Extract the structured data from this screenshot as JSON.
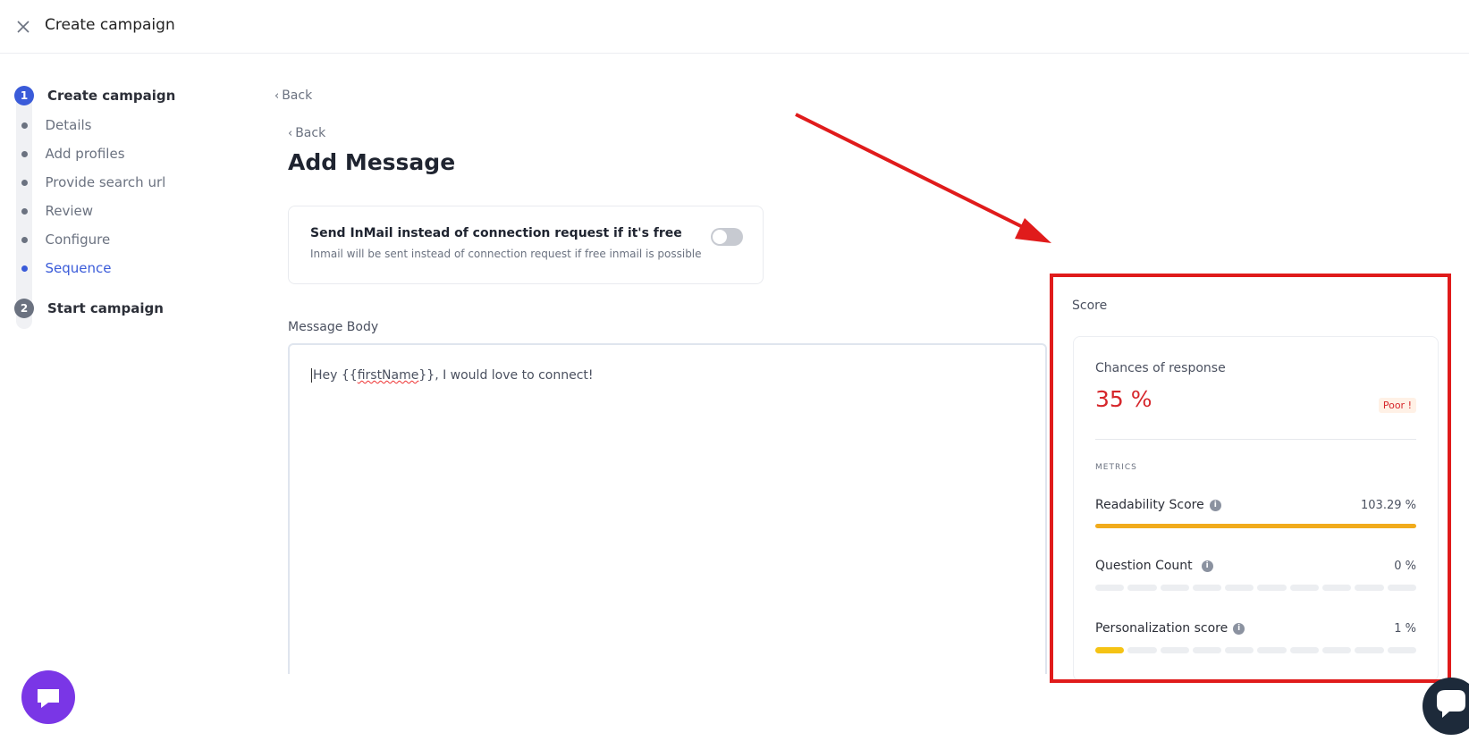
{
  "topbar": {
    "title": "Create campaign",
    "close_icon": "close-icon"
  },
  "steps": {
    "primary": [
      {
        "number": "1",
        "label": "Create campaign",
        "state": "active"
      },
      {
        "number": "2",
        "label": "Start campaign",
        "state": "inactive"
      }
    ],
    "substeps": [
      {
        "label": "Details",
        "state": "inactive"
      },
      {
        "label": "Add profiles",
        "state": "inactive"
      },
      {
        "label": "Provide search url",
        "state": "inactive"
      },
      {
        "label": "Review",
        "state": "inactive"
      },
      {
        "label": "Configure",
        "state": "inactive"
      },
      {
        "label": "Sequence",
        "state": "active"
      }
    ]
  },
  "nav": {
    "back_outer": "Back",
    "back_inner": "Back"
  },
  "page_title": "Add Message",
  "inmail": {
    "title": "Send InMail instead of connection request if it's free",
    "subtitle": "Inmail will be sent instead of connection request if free inmail is possible",
    "enabled": false
  },
  "message": {
    "label": "Message Body",
    "text_before": "Hey {{",
    "text_spell": "firstName",
    "text_after": "}}, I would love to connect!"
  },
  "score": {
    "label": "Score",
    "chances_label": "Chances of response",
    "chances_value": "35 %",
    "rating": "Poor !",
    "metrics_heading": "METRICS",
    "metrics": [
      {
        "name": "Readability Score",
        "value": "103.29 %",
        "percent": 103.29
      },
      {
        "name": "Question Count",
        "value": "0 %",
        "percent": 0
      },
      {
        "name": "Personalization score",
        "value": "1 %",
        "percent": 1
      }
    ]
  },
  "colors": {
    "accent": "#3a5bd9",
    "score_red": "#d6262b",
    "readability_bar": "#f1ab1c",
    "personalization_bar": "#f5c314",
    "annotation_red": "#e01b1b",
    "chat_purple": "#7a36e6"
  },
  "icons": {
    "info": "info-icon",
    "chevron": "chevron-left-icon",
    "chat_left": "chat-bubble-icon",
    "chat_right": "chat-icon"
  }
}
